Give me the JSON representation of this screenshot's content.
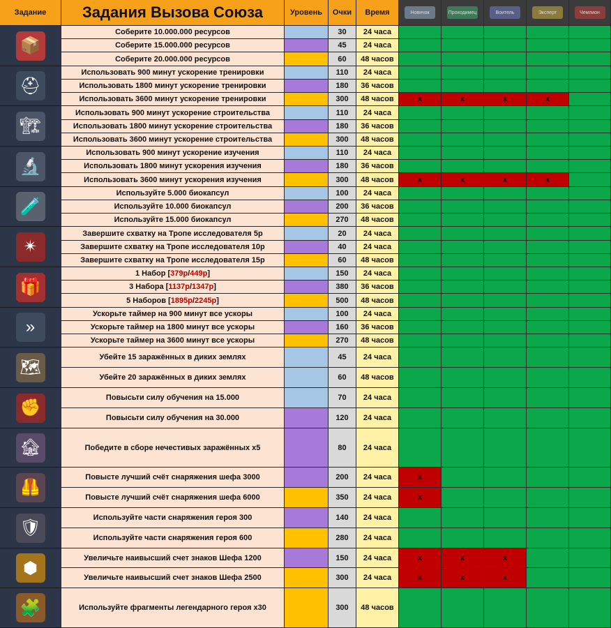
{
  "header": {
    "task_col": "Задание",
    "title": "Задания Вызова Союза",
    "level_col": "Уровень",
    "points_col": "Очки",
    "time_col": "Время"
  },
  "ranks": [
    {
      "label": "Новичок",
      "color": "#6b7a86"
    },
    {
      "label": "Проходимец",
      "color": "#3d7a5a"
    },
    {
      "label": "Воитель",
      "color": "#5a5f8a"
    },
    {
      "label": "Эксперт",
      "color": "#8a7a3d"
    },
    {
      "label": "Чемпион",
      "color": "#8a3d3d"
    }
  ],
  "colors": {
    "blue": "#a6c6e6",
    "purple": "#a779d8",
    "gold": "#ffc000",
    "green": "#0aa84a",
    "red": "#c00000"
  },
  "groups": [
    {
      "icon": "resource-crate-icon",
      "glyph": "📦",
      "tint": "#b53b3b",
      "rows": [
        {
          "task": "Соберите 10.000.000 ресурсов",
          "level": "blue",
          "points": "30",
          "time": "24 часа",
          "marks": [
            0,
            0,
            0,
            0,
            0
          ]
        },
        {
          "task": "Соберите 15.000.000 ресурсов",
          "level": "purple",
          "points": "45",
          "time": "24 часа",
          "marks": [
            0,
            0,
            0,
            0,
            0
          ]
        },
        {
          "task": "Соберите 20.000.000 ресурсов",
          "level": "gold",
          "points": "60",
          "time": "48 часов",
          "marks": [
            0,
            0,
            0,
            0,
            0
          ]
        }
      ]
    },
    {
      "icon": "training-speedup-icon",
      "glyph": "⛑",
      "tint": "#3e4a5e",
      "rows": [
        {
          "task": "Использовать 900 минут ускорение тренировки",
          "level": "blue",
          "points": "110",
          "time": "24 часа",
          "marks": [
            0,
            0,
            0,
            0,
            0
          ]
        },
        {
          "task": "Использовать 1800 минут ускорение тренировки",
          "level": "purple",
          "points": "180",
          "time": "36 часов",
          "marks": [
            0,
            0,
            0,
            0,
            0
          ]
        },
        {
          "task": "Использовать 3600 минут ускорение тренировки",
          "level": "gold",
          "points": "300",
          "time": "48 часов",
          "marks": [
            1,
            1,
            1,
            1,
            0
          ]
        }
      ]
    },
    {
      "icon": "construction-speedup-icon",
      "glyph": "🏗",
      "tint": "#4d5568",
      "rows": [
        {
          "task": "Использовать 900 минут ускорение строительства",
          "level": "blue",
          "points": "110",
          "time": "24 часа",
          "marks": [
            0,
            0,
            0,
            0,
            0
          ]
        },
        {
          "task": "Использовать 1800 минут ускорение строительства",
          "level": "purple",
          "points": "180",
          "time": "36 часов",
          "marks": [
            0,
            0,
            0,
            0,
            0
          ]
        },
        {
          "task": "Использовать 3600 минут ускорение строительства",
          "level": "gold",
          "points": "300",
          "time": "48 часов",
          "marks": [
            0,
            0,
            0,
            0,
            0
          ]
        }
      ]
    },
    {
      "icon": "research-speedup-icon",
      "glyph": "🔬",
      "tint": "#4d5568",
      "rows": [
        {
          "task": "Использовать 900 минут  ускорение изучения",
          "level": "blue",
          "points": "110",
          "time": "24 часа",
          "marks": [
            0,
            0,
            0,
            0,
            0
          ]
        },
        {
          "task": "Использовать 1800 минут ускорения изучения",
          "level": "purple",
          "points": "180",
          "time": "36 часов",
          "marks": [
            0,
            0,
            0,
            0,
            0
          ]
        },
        {
          "task": "Использовать 3600 минут ускорения изучения",
          "level": "gold",
          "points": "300",
          "time": "48 часов",
          "marks": [
            1,
            1,
            1,
            1,
            0
          ]
        }
      ]
    },
    {
      "icon": "biocapsule-icon",
      "glyph": "🧪",
      "tint": "#5a6270",
      "rows": [
        {
          "task": "Используйте 5.000 биокапсул",
          "level": "blue",
          "points": "100",
          "time": "24 часа",
          "marks": [
            0,
            0,
            0,
            0,
            0
          ]
        },
        {
          "task": "Используйте 10.000 биокапсул",
          "level": "purple",
          "points": "200",
          "time": "36 часов",
          "marks": [
            0,
            0,
            0,
            0,
            0
          ]
        },
        {
          "task": "Используйте 15.000 биокапсул",
          "level": "gold",
          "points": "270",
          "time": "48 часов",
          "marks": [
            0,
            0,
            0,
            0,
            0
          ]
        }
      ]
    },
    {
      "icon": "explorer-path-icon",
      "glyph": "✴",
      "tint": "#8a2a2a",
      "rows": [
        {
          "task": "Завершите схватку на Тропе исследователя 5р",
          "level": "blue",
          "points": "20",
          "time": "24 часа",
          "marks": [
            0,
            0,
            0,
            0,
            0
          ]
        },
        {
          "task": "Завершите схватку на Тропе исследователя 10р",
          "level": "purple",
          "points": "40",
          "time": "24 часа",
          "marks": [
            0,
            0,
            0,
            0,
            0
          ]
        },
        {
          "task": "Завершите схватку на Тропе исследователя 15р",
          "level": "gold",
          "points": "60",
          "time": "48 часов",
          "marks": [
            0,
            0,
            0,
            0,
            0
          ]
        }
      ]
    },
    {
      "icon": "gift-box-icon",
      "glyph": "🎁",
      "tint": "#a33030",
      "rows": [
        {
          "task_pre": "1 Набор [",
          "price_a": "379р",
          "task_mid": "/",
          "price_b": "449р",
          "task_post": "]",
          "level": "blue",
          "points": "150",
          "time": "24 часа",
          "marks": [
            0,
            0,
            0,
            0,
            0
          ]
        },
        {
          "task_pre": "3 Набора [",
          "price_a": "1137р",
          "task_mid": "/",
          "price_b": "1347р",
          "task_post": "]",
          "level": "purple",
          "points": "380",
          "time": "36 часов",
          "marks": [
            0,
            0,
            0,
            0,
            0
          ]
        },
        {
          "task_pre": "5 Наборов [",
          "price_a": "1895р",
          "task_mid": "/",
          "price_b": "2245р",
          "task_post": "]",
          "level": "gold",
          "points": "500",
          "time": "48 часов",
          "marks": [
            0,
            0,
            0,
            0,
            0
          ]
        }
      ]
    },
    {
      "icon": "general-speedup-icon",
      "glyph": "»",
      "tint": "#3e4a5e",
      "rows": [
        {
          "task": "Ускорьте таймер на 900 минут все ускоры",
          "level": "blue",
          "points": "100",
          "time": "24 часа",
          "marks": [
            0,
            0,
            0,
            0,
            0
          ]
        },
        {
          "task": "Ускорьте таймер на 1800 минут все ускоры",
          "level": "purple",
          "points": "160",
          "time": "36 часов",
          "marks": [
            0,
            0,
            0,
            0,
            0
          ]
        },
        {
          "task": "Ускорьте таймер на 3600 минут все ускоры",
          "level": "gold",
          "points": "270",
          "time": "48 часов",
          "marks": [
            0,
            0,
            0,
            0,
            0
          ]
        }
      ]
    },
    {
      "icon": "wasteland-map-icon",
      "glyph": "🗺",
      "tint": "#6a5a48",
      "rows": [
        {
          "task": "Убейте 15 заражённых в диких землях",
          "level": "blue",
          "points": "45",
          "time": "24 часа",
          "marks": [
            0,
            0,
            0,
            0,
            0
          ]
        },
        {
          "task": "Убейте 20 заражённых в диких землях",
          "level": "blue",
          "points": "60",
          "time": "48 часов",
          "marks": [
            0,
            0,
            0,
            0,
            0
          ]
        }
      ]
    },
    {
      "icon": "fist-power-icon",
      "glyph": "✊",
      "tint": "#8a2a2a",
      "rows": [
        {
          "task": "Повысьти силу обучения на 15.000",
          "level": "blue",
          "points": "70",
          "time": "24 часа",
          "marks": [
            0,
            0,
            0,
            0,
            0
          ]
        },
        {
          "task": "Повысьти силу обучения на 30.000",
          "level": "purple",
          "points": "120",
          "time": "24 часа",
          "marks": [
            0,
            0,
            0,
            0,
            0
          ]
        }
      ]
    },
    {
      "icon": "infected-lair-icon",
      "glyph": "🏚",
      "tint": "#5a4a6a",
      "rows": [
        {
          "task": "Победите в сборе нечестивых заражённых х5",
          "level": "purple",
          "points": "80",
          "time": "24 часа",
          "marks": [
            0,
            0,
            0,
            0,
            0
          ]
        }
      ]
    },
    {
      "icon": "chief-gear-icon",
      "glyph": "🦺",
      "tint": "#5a4550",
      "rows": [
        {
          "task": "Повысте лучший счёт снаряжения шефа 3000",
          "level": "purple",
          "points": "200",
          "time": "24 часа",
          "marks": [
            1,
            0,
            0,
            0,
            0
          ]
        },
        {
          "task": "Повысте лучший счёт снаряжения шефа 6000",
          "level": "gold",
          "points": "350",
          "time": "24 часа",
          "marks": [
            1,
            0,
            0,
            0,
            0
          ]
        }
      ]
    },
    {
      "icon": "hero-gear-icon",
      "glyph": "🛡",
      "tint": "#4a4a58",
      "rows": [
        {
          "task": "Используйте части снаряжения героя 300",
          "level": "purple",
          "points": "140",
          "time": "24 часа",
          "marks": [
            0,
            0,
            0,
            0,
            0
          ]
        },
        {
          "task": "Используйте части снаряжения героя 600",
          "level": "gold",
          "points": "280",
          "time": "24 часа",
          "marks": [
            0,
            0,
            0,
            0,
            0
          ]
        }
      ]
    },
    {
      "icon": "chief-charm-icon",
      "glyph": "⬢",
      "tint": "#a3741a",
      "rows": [
        {
          "task": "Увеличьте наивысший счет знаков Шефа 1200",
          "level": "purple",
          "points": "150",
          "time": "24 часа",
          "marks": [
            1,
            1,
            1,
            0,
            0
          ]
        },
        {
          "task": "Увеличьте наивысший счет знаков Шефа 2500",
          "level": "gold",
          "points": "300",
          "time": "24 часа",
          "marks": [
            1,
            1,
            1,
            0,
            0
          ]
        }
      ]
    },
    {
      "icon": "hero-fragment-icon",
      "glyph": "🧩",
      "tint": "#8a5a2a",
      "rows": [
        {
          "task": "Используйте фрагменты легендарного героя х30",
          "level": "gold",
          "points": "300",
          "time": "48 часов",
          "marks": [
            0,
            0,
            0,
            0,
            0
          ]
        }
      ]
    }
  ]
}
